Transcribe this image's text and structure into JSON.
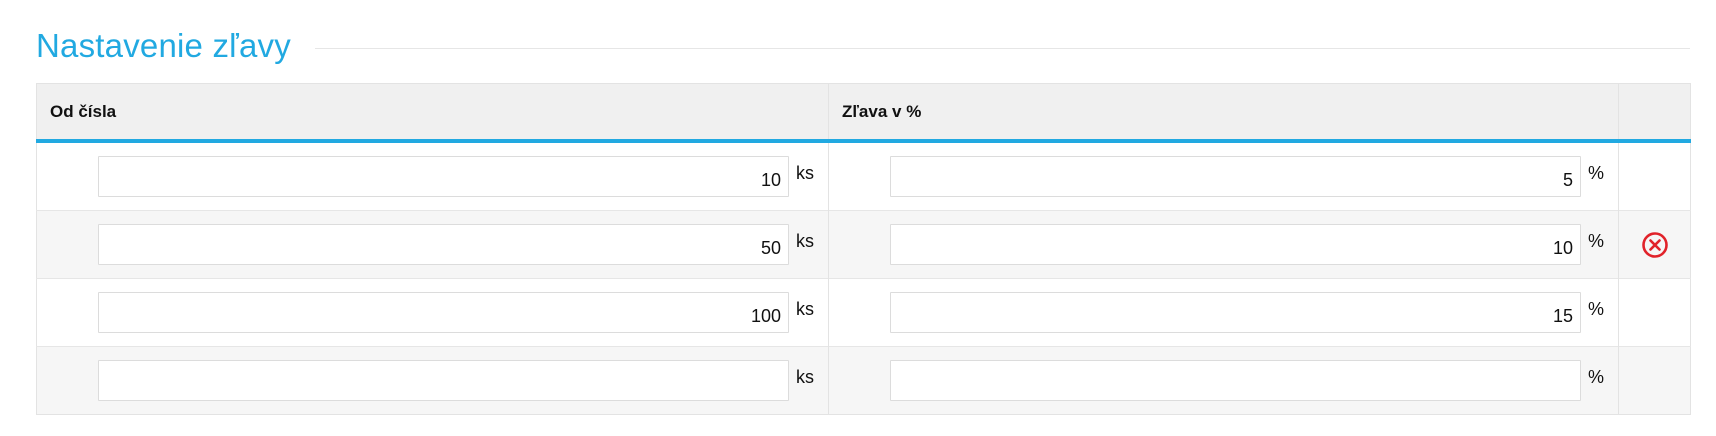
{
  "section": {
    "title": "Nastavenie zľavy"
  },
  "table": {
    "headers": {
      "from_number": "Od čísla",
      "discount": "Zľava v %",
      "actions": ""
    },
    "unit_qty": "ks",
    "unit_pct": "%",
    "rows": [
      {
        "from": "10",
        "discount": "5",
        "has_delete": false
      },
      {
        "from": "50",
        "discount": "10",
        "has_delete": true
      },
      {
        "from": "100",
        "discount": "15",
        "has_delete": false
      },
      {
        "from": "",
        "discount": "",
        "has_delete": false
      }
    ]
  },
  "colors": {
    "accent": "#21a9e1",
    "delete": "#e1222a"
  },
  "icons": {
    "delete": "remove-circle-icon"
  }
}
